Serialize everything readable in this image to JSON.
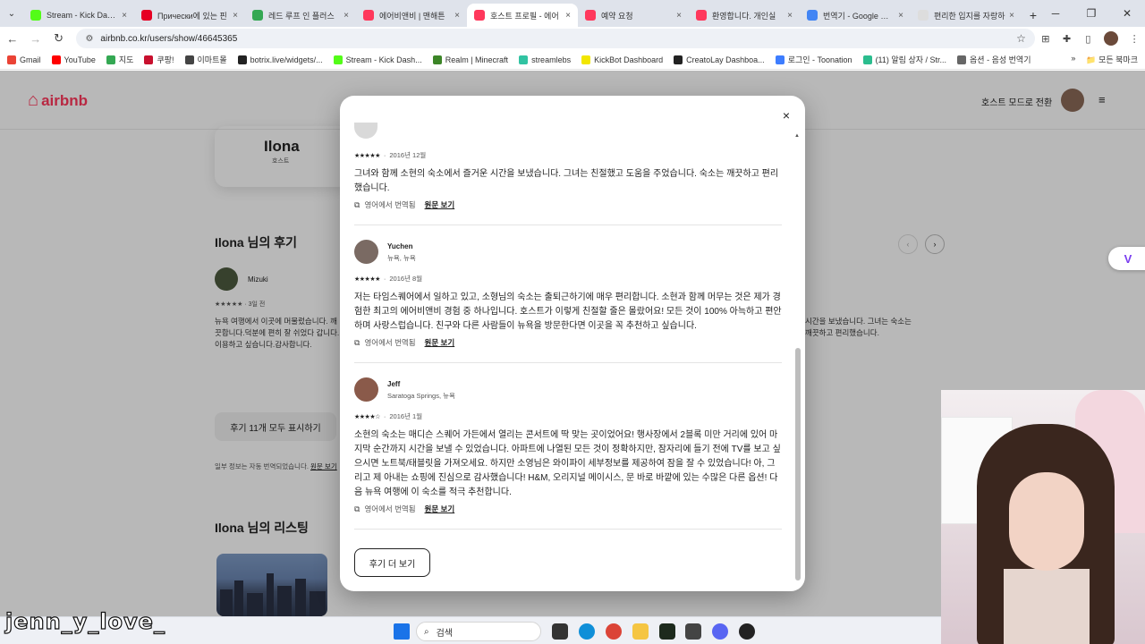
{
  "browser": {
    "tabs": [
      {
        "label": "Stream - Kick Dashbo",
        "color": "#53fc18"
      },
      {
        "label": "Прически에 있는 핀",
        "color": "#e60023"
      },
      {
        "label": "레드 루프 인 플러스",
        "color": "#34a853"
      },
      {
        "label": "에어비앤비 | 맨해튼",
        "color": "#ff385c"
      },
      {
        "label": "호스트 프로필 - 에어",
        "color": "#ff385c",
        "active": true
      },
      {
        "label": "예약 요청",
        "color": "#ff385c"
      },
      {
        "label": "환영합니다. 개인실",
        "color": "#ff385c"
      },
      {
        "label": "번역기 - Google 검색",
        "color": "#4285f4"
      },
      {
        "label": "편리한 입지를 자랑하",
        "color": "#dddddd"
      }
    ],
    "url": "airbnb.co.kr/users/show/46645365",
    "bookmarks": [
      {
        "label": "Gmail",
        "color": "#ea4335"
      },
      {
        "label": "YouTube",
        "color": "#ff0000"
      },
      {
        "label": "지도",
        "color": "#34a853"
      },
      {
        "label": "쿠팡!",
        "color": "#c8102e"
      },
      {
        "label": "이마트몰",
        "color": "#444444"
      },
      {
        "label": "botrix.live/widgets/...",
        "color": "#222222"
      },
      {
        "label": "Stream - Kick Dash...",
        "color": "#53fc18"
      },
      {
        "label": "Realm | Minecraft",
        "color": "#3c8527"
      },
      {
        "label": "streamlebs",
        "color": "#31c3a2"
      },
      {
        "label": "KickBot Dashboard",
        "color": "#f2e600"
      },
      {
        "label": "CreatoLay Dashboa...",
        "color": "#222222"
      },
      {
        "label": "로그인 - Toonation",
        "color": "#3d7dff"
      },
      {
        "label": "(11) 알림 상자 / Str...",
        "color": "#2bbd8e"
      },
      {
        "label": "옵션 - 음성 번역기",
        "color": "#666666"
      }
    ],
    "bookmarks_right": "모든 북마크"
  },
  "page": {
    "logo": "airbnb",
    "host_switch": "호스트 모드로 전환",
    "profile_name": "Ilona",
    "profile_role": "호스트",
    "reviews_title": "Ilona 님의 후기",
    "bg_review": {
      "name": "Mizuki",
      "meta": "★★★★★ · 3일 전",
      "text": "뉴욕 여행에서 이곳에 머물렀습니다. 깨끗합니다.덕분에 편히 잘 쉬었다 갑니다. 이용하고 싶습니다.감사합니다."
    },
    "bg_right_text": "시간을 보냈습니다. 그녀는 숙소는 깨끗하고 편리했습니다.",
    "show_all": "후기 11개 모두 표시하기",
    "auto_note": "일부 정보는 자동 번역되었습니다.",
    "auto_note_link": "원문 보기",
    "listings_title": "Ilona 님의 리스팅"
  },
  "modal": {
    "close_icon": "×",
    "top_review": {
      "date": "2016년 12월",
      "stars": "★★★★★",
      "text": "그녀와 함께 소현의 숙소에서 즐거운 시간을 보냈습니다. 그녀는 친절했고 도움을 주었습니다. 숙소는 깨끗하고 편리했습니다.",
      "translated": "영어에서 번역됨",
      "original": "원문 보기"
    },
    "reviews": [
      {
        "name": "Yuchen",
        "location": "뉴욕, 뉴욕",
        "stars": "★★★★★",
        "date": "2016년 8월",
        "text": "저는 타임스퀘어에서 일하고 있고, 소형님의 숙소는 출퇴근하기에 매우 편리합니다. 소현과 함께 머무는 것은 제가 경험한 최고의 에어비앤비 경험 중 하나입니다. 호스트가 이렇게 친절할 줄은 몰랐어요! 모든 것이 100% 아늑하고 편안하며 사랑스럽습니다. 친구와 다른 사람들이 뉴욕을 방문한다면 이곳을 꼭 추천하고 싶습니다.",
        "translated": "영어에서 번역됨",
        "original": "원문 보기",
        "avatar_color": "#7a6a63"
      },
      {
        "name": "Jeff",
        "location": "Saratoga Springs, 뉴욕",
        "stars": "★★★★☆",
        "date": "2016년 1월",
        "text": "소현의 숙소는 매디슨 스퀘어 가든에서 열리는 콘서트에 딱 맞는 곳이었어요! 행사장에서 2블록 미만 거리에 있어 마지막 순간까지 시간을 보낼 수 있었습니다. 아파트에 나열된 모든 것이 정확하지만, 잠자리에 들기 전에 TV를 보고 싶으시면 노트북/태블릿을 가져오세요. 하지만 소영님은 와이파이 세부정보를 제공하여 잠을 잘 수 있었습니다! 아, 그리고 제 아내는 쇼핑에 진심으로 감사했습니다! H&M, 오리지널 메이시스, 문 바로 바깥에 있는 수많은 다른 옵션! 다음 뉴욕 여행에 이 숙소를 적극 추천합니다.",
        "translated": "영어에서 번역됨",
        "original": "원문 보기",
        "avatar_color": "#8a5a4a"
      }
    ],
    "more_button": "후기 더 보기"
  },
  "overlay": {
    "watermark": "jenn_y_love_",
    "side_badge": "V"
  },
  "taskbar": {
    "search": "검색"
  },
  "colors": {
    "brand": "#ff385c",
    "text": "#222222"
  }
}
